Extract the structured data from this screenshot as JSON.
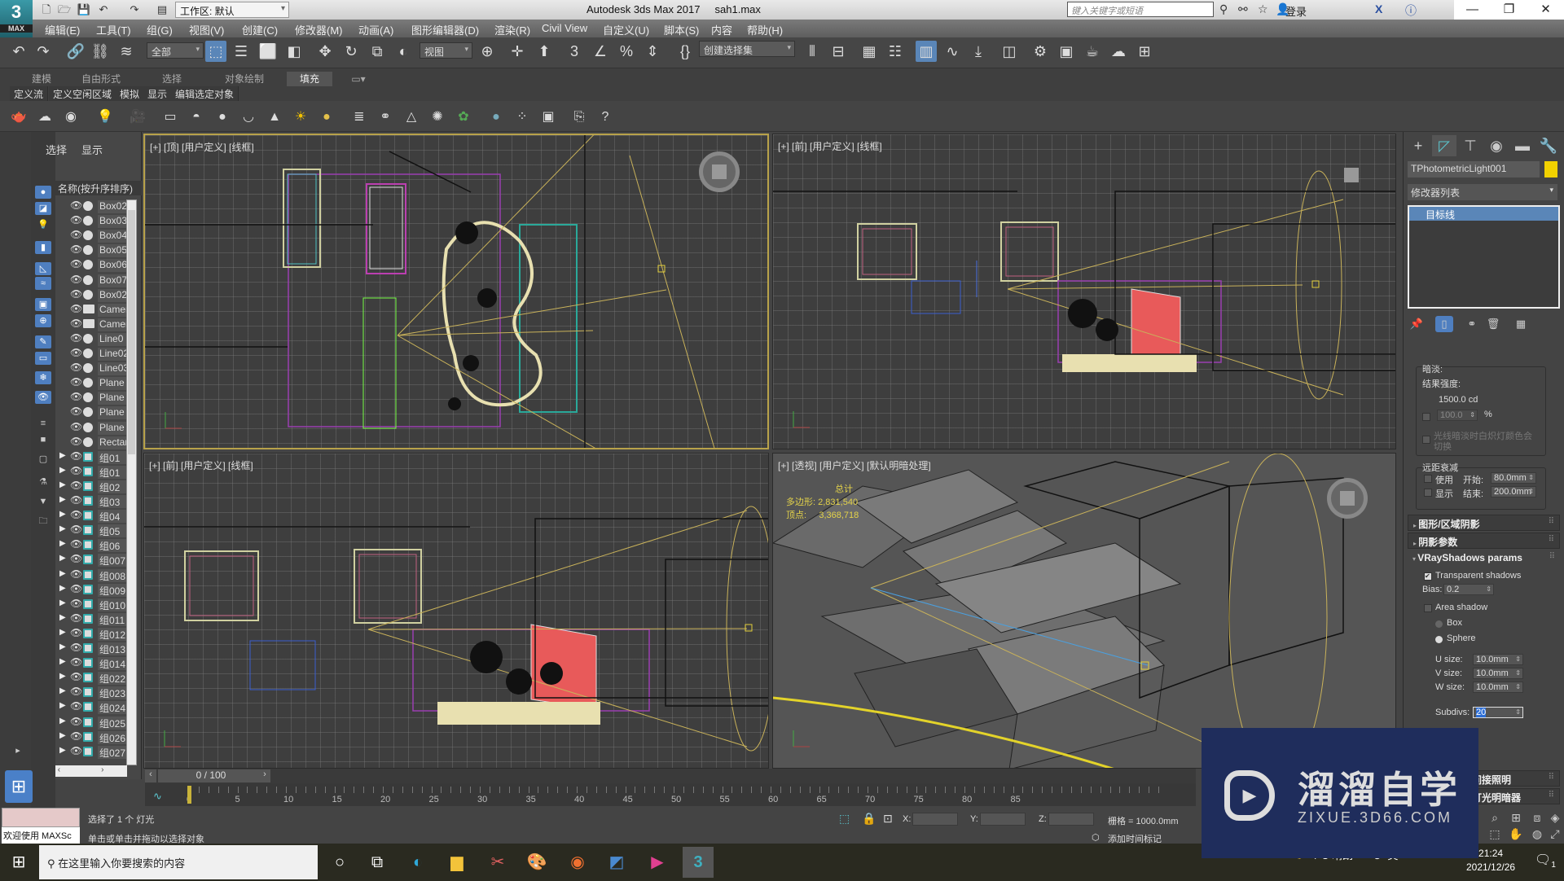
{
  "app": {
    "logo": "3",
    "logo_sub": "MAX",
    "title": "Autodesk 3ds Max 2017",
    "file": "sah1.max",
    "workspace": "工作区: 默认",
    "search_placeholder": "键入关键字或短语",
    "login": "登录"
  },
  "menu": [
    "编辑(E)",
    "工具(T)",
    "组(G)",
    "视图(V)",
    "创建(C)",
    "修改器(M)",
    "动画(A)",
    "图形编辑器(D)",
    "渲染(R)",
    "Civil View",
    "自定义(U)",
    "脚本(S)",
    "内容",
    "帮助(H)"
  ],
  "toolbar": {
    "selection_filter": "全部",
    "ref_coord": "视图",
    "named_selection": "创建选择集"
  },
  "ribbon": {
    "tabs": [
      "建模",
      "自由形式",
      "选择",
      "对象绘制",
      "填充"
    ],
    "active_tab": "填充",
    "subtabs": [
      "定义流",
      "定义空闲区域",
      "模拟",
      "显示",
      "编辑选定对象"
    ]
  },
  "explorer": {
    "tabs": [
      "选择",
      "显示"
    ],
    "header": "名称(按升序排序)",
    "items": [
      {
        "name": "Box02",
        "type": "geo",
        "expand": false
      },
      {
        "name": "Box03",
        "type": "geo",
        "expand": false
      },
      {
        "name": "Box04",
        "type": "geo",
        "expand": false
      },
      {
        "name": "Box05",
        "type": "geo",
        "expand": false
      },
      {
        "name": "Box06",
        "type": "geo",
        "expand": false
      },
      {
        "name": "Box07",
        "type": "geo",
        "expand": false
      },
      {
        "name": "Box02",
        "type": "geo",
        "expand": false
      },
      {
        "name": "Camera",
        "type": "cam",
        "expand": false
      },
      {
        "name": "Camera",
        "type": "cam",
        "expand": false
      },
      {
        "name": "Line0",
        "type": "shape",
        "expand": false
      },
      {
        "name": "Line02",
        "type": "geo",
        "expand": false
      },
      {
        "name": "Line03",
        "type": "shape",
        "expand": false
      },
      {
        "name": "Plane",
        "type": "geo",
        "expand": false
      },
      {
        "name": "Plane",
        "type": "geo",
        "expand": false
      },
      {
        "name": "Plane",
        "type": "geo",
        "expand": false
      },
      {
        "name": "Plane",
        "type": "geo",
        "expand": false
      },
      {
        "name": "Rectangle",
        "type": "shape",
        "expand": false
      },
      {
        "name": "组01",
        "type": "grp",
        "expand": true
      },
      {
        "name": "组01",
        "type": "grp",
        "expand": true
      },
      {
        "name": "组02",
        "type": "grp",
        "expand": true
      },
      {
        "name": "组03",
        "type": "grp",
        "expand": true
      },
      {
        "name": "组04",
        "type": "grp",
        "expand": true
      },
      {
        "name": "组05",
        "type": "grp",
        "expand": true
      },
      {
        "name": "组06",
        "type": "grp",
        "expand": true
      },
      {
        "name": "组007",
        "type": "grp",
        "expand": true
      },
      {
        "name": "组008",
        "type": "grp",
        "expand": true
      },
      {
        "name": "组009",
        "type": "grp",
        "expand": true
      },
      {
        "name": "组010",
        "type": "grp",
        "expand": true
      },
      {
        "name": "组011",
        "type": "grp",
        "expand": true
      },
      {
        "name": "组012",
        "type": "grp",
        "expand": true
      },
      {
        "name": "组013",
        "type": "grp",
        "expand": true
      },
      {
        "name": "组014",
        "type": "grp",
        "expand": true
      },
      {
        "name": "组022",
        "type": "grp",
        "expand": true
      },
      {
        "name": "组023",
        "type": "grp",
        "expand": true
      },
      {
        "name": "组024",
        "type": "grp",
        "expand": true
      },
      {
        "name": "组025",
        "type": "grp",
        "expand": true
      },
      {
        "name": "组026",
        "type": "grp",
        "expand": true
      },
      {
        "name": "组027",
        "type": "grp",
        "expand": true
      }
    ]
  },
  "viewports": {
    "top": "[+] [顶] [用户定义] [线框]",
    "front": "[+] [前] [用户定义] [线框]",
    "front2": "[+] [前] [用户定义] [线框]",
    "persp": "[+] [透视] [用户定义] [默认明暗处理]",
    "stats": {
      "title": "总计",
      "poly_label": "多边形:",
      "poly": "2,831,540",
      "vert_label": "顶点:",
      "vert": "3,368,718"
    }
  },
  "command_panel": {
    "object_name": "TPhotometricLight001",
    "object_color": "#f2d200",
    "modifier_list": "修改器列表",
    "stack_item": "目标线",
    "dimming_title": "暗淡:",
    "result_intensity_label": "结果强度:",
    "result_intensity": "1500.0 cd",
    "percent_value": "100.0",
    "percent_sign": "%",
    "incandescent_label": "光线暗淡时白炽灯颜色会切换",
    "far_atten_title": "远距衰减",
    "use_label": "使用",
    "show_label": "显示",
    "start_label": "开始:",
    "start_value": "80.0mm",
    "end_label": "结束:",
    "end_value": "200.0mm",
    "rollouts": [
      "图形/区域阴影",
      "阴影参数",
      "VRayShadows params"
    ],
    "vray": {
      "transparent_label": "Transparent shadows",
      "transparent_checked": true,
      "bias_label": "Bias:",
      "bias": "0.2",
      "area_label": "Area shadow",
      "area_checked": false,
      "box_label": "Box",
      "sphere_label": "Sphere",
      "shape_selected": "Sphere",
      "u_label": "U size:",
      "u": "10.0mm",
      "v_label": "V size:",
      "v": "10.0mm",
      "w_label": "W size:",
      "w": "10.0mm",
      "subdivs_label": "Subdivs:",
      "subdivs": "20"
    },
    "lower_rollouts": [
      "间接照明",
      "灯光明暗器"
    ]
  },
  "timeline": {
    "frame_display": "0 / 100",
    "current_frame": 0,
    "total_frames": 100,
    "labels": [
      "0",
      "5",
      "10",
      "15",
      "20",
      "25",
      "30",
      "35",
      "40",
      "45",
      "50",
      "55",
      "60",
      "65",
      "70",
      "75",
      "80",
      "85"
    ]
  },
  "status": {
    "maxscript_input": "欢迎使用 MAXSc",
    "selection_msg": "选择了 1 个 灯光",
    "prompt": "单击或单击并拖动以选择对象",
    "x_label": "X:",
    "y_label": "Y:",
    "z_label": "Z:",
    "grid": "栅格 = 1000.0mm",
    "add_time_tag": "添加时间标记"
  },
  "taskbar": {
    "search_placeholder": "在这里输入你要搜索的内容",
    "weather": "-4°C 晴朗",
    "ime": "英",
    "time": "21:24",
    "date": "2021/12/26",
    "notifications": "1"
  },
  "watermark": {
    "title": "溜溜自学",
    "url": "ZIXUE.3D66.COM"
  }
}
